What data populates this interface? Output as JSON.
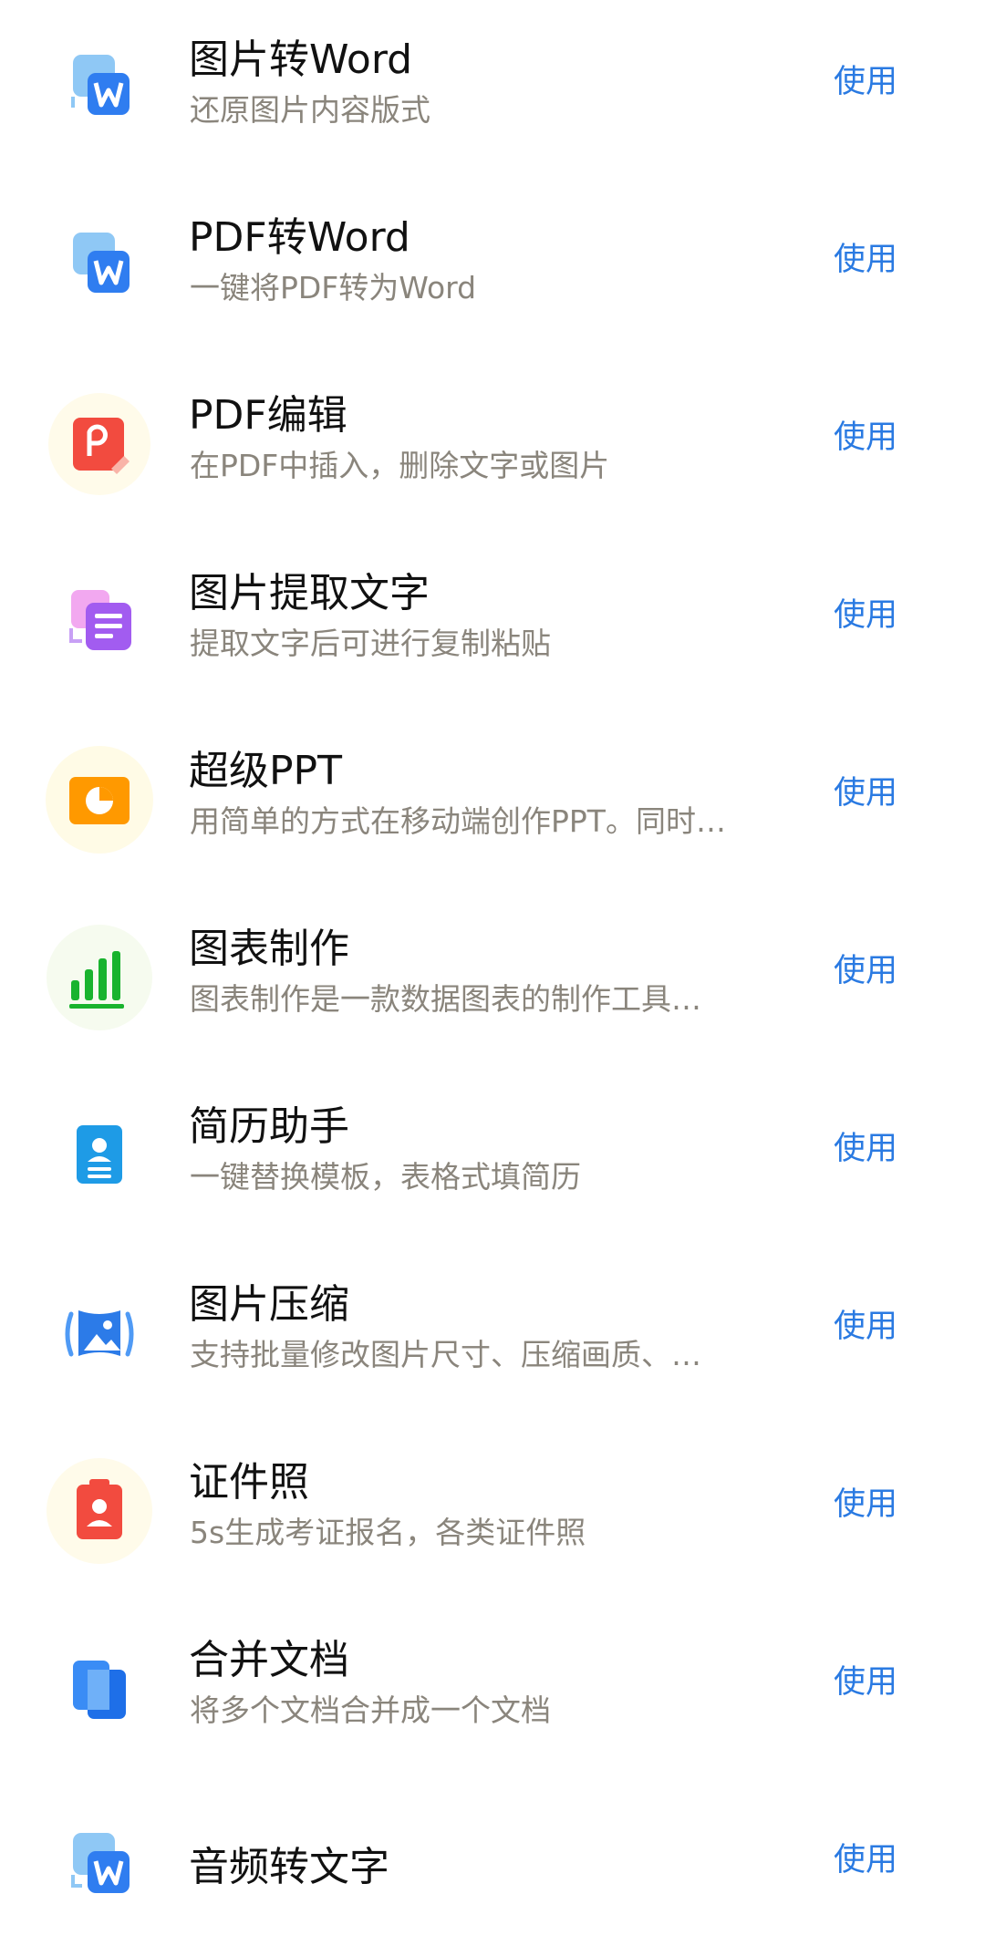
{
  "accent_color": "#2a7ae2",
  "subtitle_color": "#8a857c",
  "items": [
    {
      "title": "图片转Word",
      "subtitle": "还原图片内容版式",
      "action": "使用",
      "icon": "image-to-word-icon"
    },
    {
      "title": "PDF转Word",
      "subtitle": "一键将PDF转为Word",
      "action": "使用",
      "icon": "pdf-to-word-icon"
    },
    {
      "title": "PDF编辑",
      "subtitle": "在PDF中插入，删除文字或图片",
      "action": "使用",
      "icon": "pdf-edit-icon"
    },
    {
      "title": "图片提取文字",
      "subtitle": "提取文字后可进行复制粘贴",
      "action": "使用",
      "icon": "image-text-extract-icon"
    },
    {
      "title": "超级PPT",
      "subtitle": "用简单的方式在移动端创作PPT。同时…",
      "action": "使用",
      "icon": "ppt-icon"
    },
    {
      "title": "图表制作",
      "subtitle": "图表制作是一款数据图表的制作工具…",
      "action": "使用",
      "icon": "bar-chart-icon"
    },
    {
      "title": "简历助手",
      "subtitle": "一键替换模板，表格式填简历",
      "action": "使用",
      "icon": "resume-icon"
    },
    {
      "title": "图片压缩",
      "subtitle": "支持批量修改图片尺寸、压缩画质、…",
      "action": "使用",
      "icon": "image-compress-icon"
    },
    {
      "title": "证件照",
      "subtitle": "5s生成考证报名，各类证件照",
      "action": "使用",
      "icon": "id-photo-icon"
    },
    {
      "title": "合并文档",
      "subtitle": "将多个文档合并成一个文档",
      "action": "使用",
      "icon": "merge-docs-icon"
    },
    {
      "title": "音频转文字",
      "subtitle": "",
      "action": "使用",
      "icon": "audio-to-text-icon"
    }
  ]
}
